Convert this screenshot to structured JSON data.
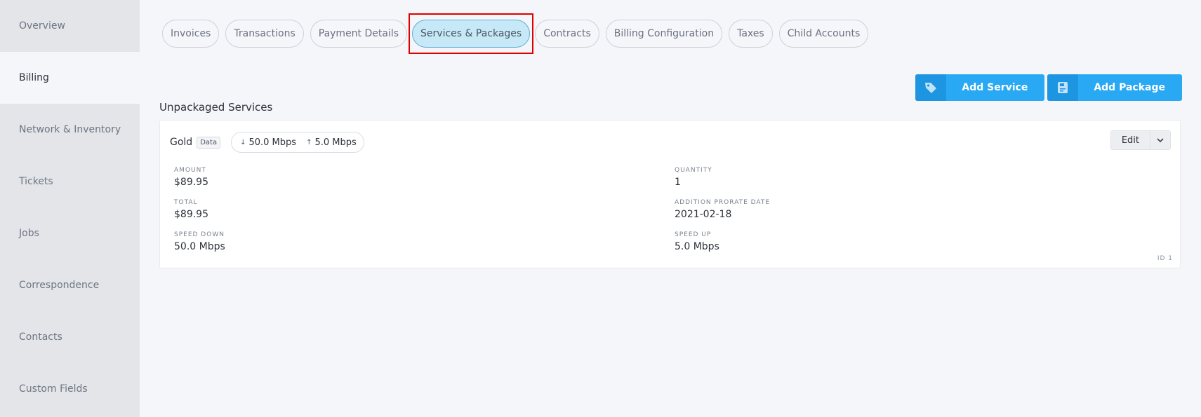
{
  "sidebar": {
    "items": [
      {
        "label": "Overview",
        "active": false
      },
      {
        "label": "Billing",
        "active": true
      },
      {
        "label": "Network & Inventory",
        "active": false
      },
      {
        "label": "Tickets",
        "active": false
      },
      {
        "label": "Jobs",
        "active": false
      },
      {
        "label": "Correspondence",
        "active": false
      },
      {
        "label": "Contacts",
        "active": false
      },
      {
        "label": "Custom Fields",
        "active": false
      }
    ]
  },
  "tabs": [
    {
      "label": "Invoices"
    },
    {
      "label": "Transactions"
    },
    {
      "label": "Payment Details"
    },
    {
      "label": "Services & Packages",
      "active": true
    },
    {
      "label": "Contracts"
    },
    {
      "label": "Billing Configuration"
    },
    {
      "label": "Taxes"
    },
    {
      "label": "Child Accounts"
    }
  ],
  "actions": {
    "add_service": {
      "label": "Add Service",
      "icon": "tag-icon"
    },
    "add_package": {
      "label": "Add Package",
      "icon": "package-icon"
    }
  },
  "section_title": "Unpackaged Services",
  "service": {
    "name": "Gold",
    "badge": "Data",
    "speed_down": "50.0 Mbps",
    "speed_up": "5.0 Mbps",
    "edit_label": "Edit",
    "fields": {
      "amount": {
        "label": "AMOUNT",
        "value": "$89.95"
      },
      "quantity": {
        "label": "QUANTITY",
        "value": "1"
      },
      "total": {
        "label": "TOTAL",
        "value": "$89.95"
      },
      "prorate": {
        "label": "ADDITION PRORATE DATE",
        "value": "2021-02-18"
      },
      "speed_down": {
        "label": "SPEED DOWN",
        "value": "50.0 Mbps"
      },
      "speed_up": {
        "label": "SPEED UP",
        "value": "5.0 Mbps"
      }
    },
    "id_label": "ID 1"
  },
  "colors": {
    "accent": "#29a8f3",
    "accent_dark": "#1e95e0",
    "active_tab_bg": "#c6e8f7",
    "highlight_border": "#e00000"
  }
}
